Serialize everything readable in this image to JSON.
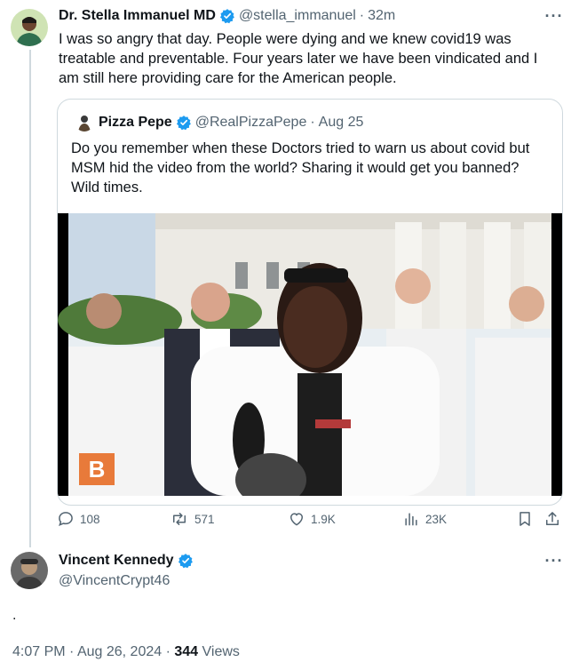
{
  "main_tweet": {
    "display_name": "Dr. Stella Immanuel MD",
    "handle": "@stella_immanuel",
    "separator": "·",
    "time": "32m",
    "text": "I was so angry that day. People were dying and we knew covid19 was treatable and preventable. Four years later we have been vindicated and I am still here providing care for the American people.",
    "more": "···"
  },
  "quote_tweet": {
    "display_name": "Pizza Pepe",
    "handle": "@RealPizzaPepe",
    "separator": "·",
    "date": "Aug 25",
    "text": "Do you remember when these Doctors tried to warn us about covid but MSM hid the video from the world? Sharing it would get you banned? Wild times.",
    "media_badge": "B"
  },
  "actions": {
    "replies": "108",
    "reposts": "571",
    "likes": "1.9K",
    "views": "23K"
  },
  "reply_tweet": {
    "display_name": "Vincent Kennedy",
    "handle": "@VincentCrypt46",
    "text": ".",
    "more": "···"
  },
  "footer": {
    "time": "4:07 PM",
    "sep1": "·",
    "date": "Aug 26, 2024",
    "sep2": "·",
    "views_count": "344",
    "views_label": "Views"
  },
  "colors": {
    "verified": "#1d9bf0",
    "secondary_text": "#536471",
    "primary_text": "#0f1419",
    "border": "#cfd9de"
  }
}
